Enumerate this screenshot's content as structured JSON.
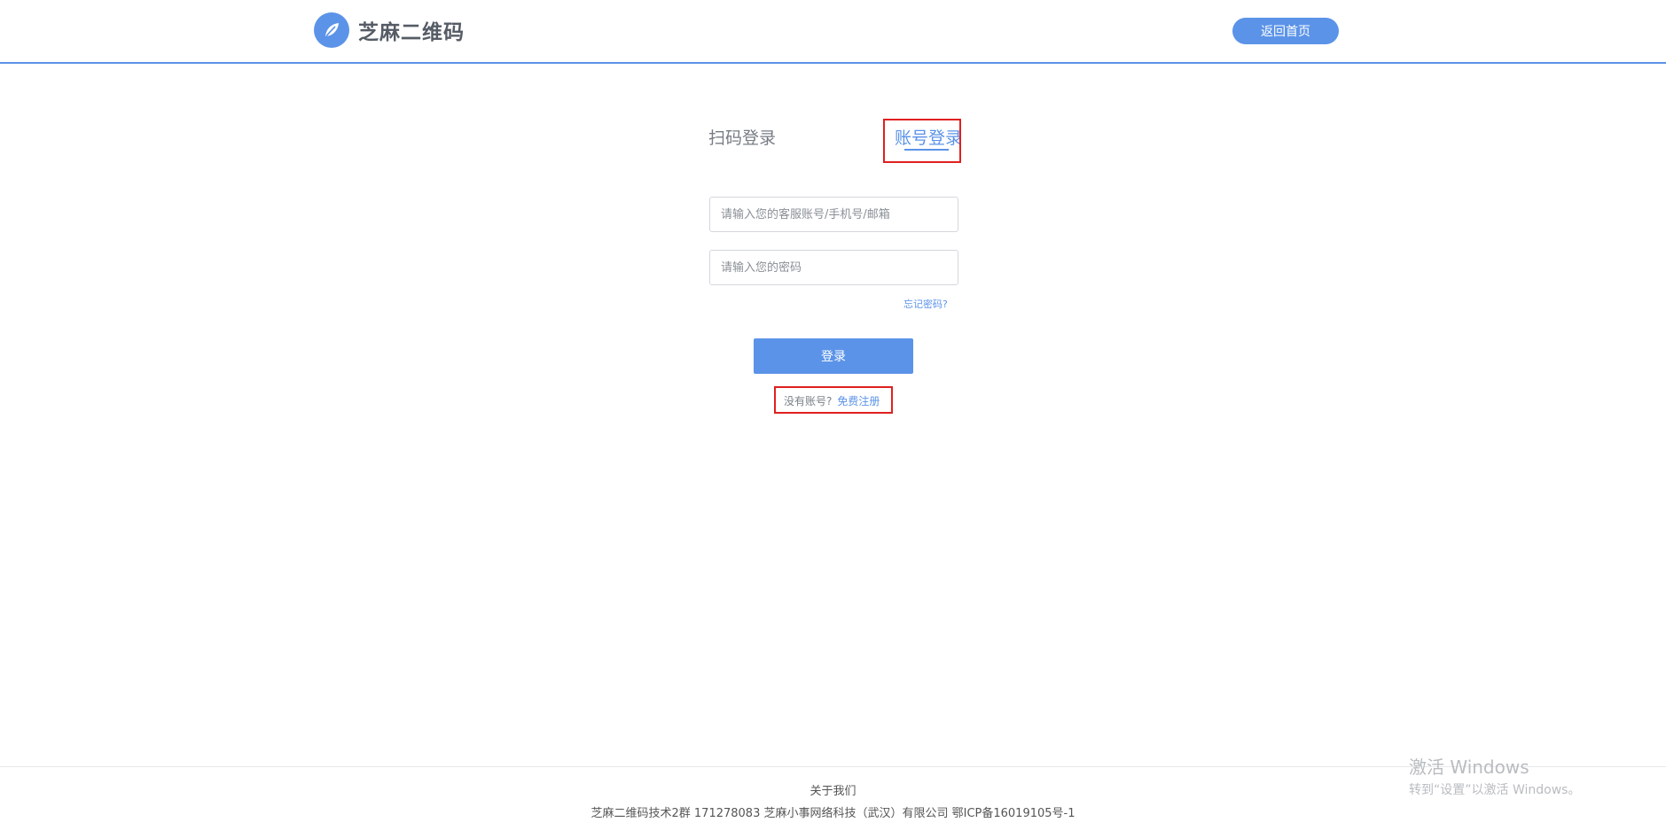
{
  "header": {
    "logo_text": "芝麻二维码",
    "home_button": "返回首页"
  },
  "tabs": {
    "scan": "扫码登录",
    "account": "账号登录",
    "active": "account"
  },
  "form": {
    "account_placeholder": "请输入您的客服账号/手机号/邮箱",
    "password_placeholder": "请输入您的密码",
    "forgot_link": "忘记密码?",
    "login_button": "登录",
    "no_account_text": "没有账号?",
    "register_link": "免费注册"
  },
  "footer": {
    "about": "关于我们",
    "info": "芝麻二维码技术2群 171278083 芝麻小事网络科技（武汉）有限公司 鄂ICP备16019105号-1"
  },
  "watermark": {
    "title": "激活 Windows",
    "subtitle": "转到“设置”以激活 Windows。"
  },
  "colors": {
    "accent": "#5b93e8",
    "highlight": "#e02020"
  },
  "icons": {
    "logo": "leaf-logo-icon"
  }
}
